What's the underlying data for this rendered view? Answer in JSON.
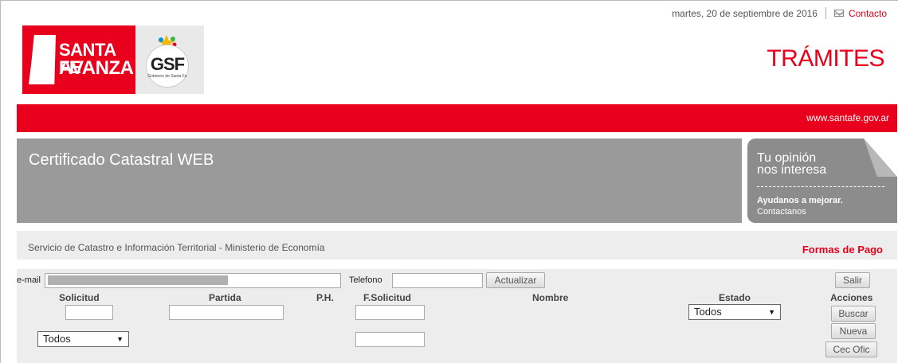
{
  "topbar": {
    "date": "martes, 20 de septiembre de 2016",
    "contact_label": "Contacto"
  },
  "header": {
    "logo_line1": "SANTA FE",
    "logo_line2": "AVANZA",
    "gsf_text": "GSF",
    "gsf_sub": "Gobierno de Santa Fe",
    "page_heading": "TRÁMITES",
    "site_url": "www.santafe.gov.ar"
  },
  "banner": {
    "title": "Certificado Catastral WEB"
  },
  "opinion": {
    "line1": "Tu opinión",
    "line2": "nos interesa",
    "cta": "Ayudanos a mejorar.",
    "sub": "Contactanos"
  },
  "strip": {
    "ministry": "Servicio de Catastro e Información Territorial - Ministerio de Economía",
    "payment_link": "Formas de Pago"
  },
  "form": {
    "email_label": "e-mail",
    "email_value": "",
    "phone_label": "Telefono",
    "phone_value": "",
    "update_button": "Actualizar",
    "logout_button": "Salir",
    "columns": {
      "solicitud": "Solicitud",
      "partida": "Partida",
      "ph": "P.H.",
      "fsolicitud": "F.Solicitud",
      "nombre": "Nombre",
      "estado": "Estado",
      "acciones": "Acciones"
    },
    "estado_selected": "Todos",
    "tipo_selected": "Todos",
    "buttons": {
      "buscar": "Buscar",
      "nueva": "Nueva",
      "cec_ofic": "Cec Ofic"
    }
  }
}
